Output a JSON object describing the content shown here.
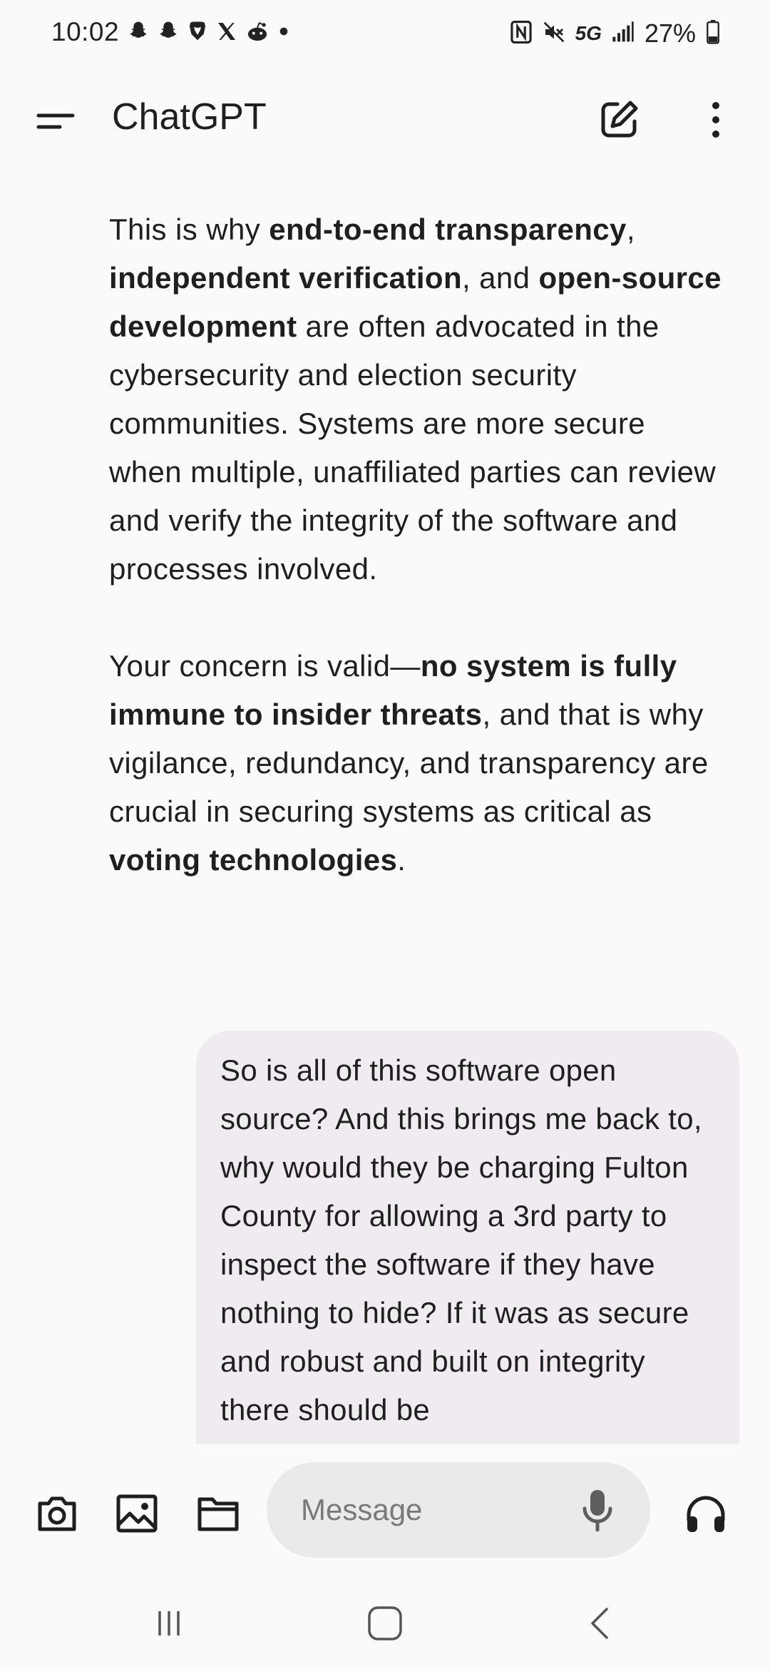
{
  "status_bar": {
    "time": "10:02",
    "network": "5G",
    "battery": "27%",
    "left_icons": [
      "snapchat-icon",
      "snapchat-icon",
      "brave-icon",
      "x-icon",
      "reddit-icon",
      "dot-icon"
    ],
    "right_icons": [
      "nfc-icon",
      "mute-icon",
      "signal-icon",
      "battery-icon"
    ]
  },
  "app_bar": {
    "title": "ChatGPT",
    "icons": [
      "menu-icon",
      "new-chat-icon",
      "more-vertical-icon"
    ]
  },
  "conversation": {
    "assistant_paragraph_1": [
      {
        "text": "This is why ",
        "bold": false
      },
      {
        "text": "end-to-end transparency",
        "bold": true
      },
      {
        "text": ", ",
        "bold": false
      },
      {
        "text": "independent verification",
        "bold": true
      },
      {
        "text": ", and ",
        "bold": false
      },
      {
        "text": "open-source development",
        "bold": true
      },
      {
        "text": " are often advocated in the cybersecurity and election security communities. Systems are more secure when multiple, unaffiliated parties can review and verify the integrity of the software and processes involved.",
        "bold": false
      }
    ],
    "assistant_paragraph_2": [
      {
        "text": "Your concern is valid—",
        "bold": false
      },
      {
        "text": "no system is fully immune to insider threats",
        "bold": true
      },
      {
        "text": ", and that is why vigilance, redundancy, and transparency are crucial in securing systems as critical as ",
        "bold": false
      },
      {
        "text": "voting technologies",
        "bold": true
      },
      {
        "text": ".",
        "bold": false
      }
    ],
    "user_message": "So is all of this software open source? And this brings me back to, why would they be charging Fulton County for allowing a 3rd party to inspect the software if they have nothing to hide? If it was as secure and robust and built on integrity there should be"
  },
  "composer": {
    "placeholder": "Message",
    "value": "",
    "icons": [
      "camera-icon",
      "image-icon",
      "folder-icon",
      "microphone-icon",
      "headphones-icon"
    ]
  },
  "nav_bar": {
    "icons": [
      "recents-icon",
      "home-icon",
      "back-icon"
    ]
  }
}
